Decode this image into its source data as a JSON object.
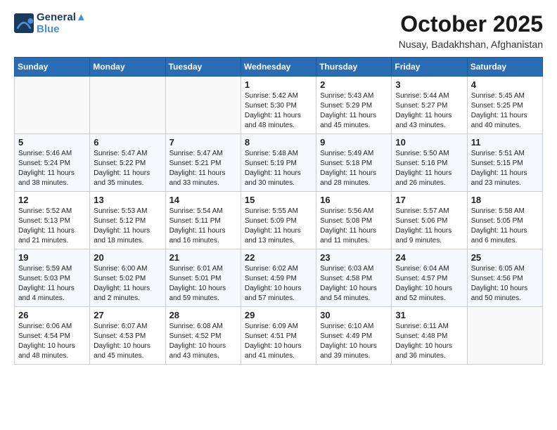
{
  "header": {
    "logo_line1": "General",
    "logo_line2": "Blue",
    "month": "October 2025",
    "location": "Nusay, Badakhshan, Afghanistan"
  },
  "weekdays": [
    "Sunday",
    "Monday",
    "Tuesday",
    "Wednesday",
    "Thursday",
    "Friday",
    "Saturday"
  ],
  "weeks": [
    [
      {
        "day": "",
        "info": ""
      },
      {
        "day": "",
        "info": ""
      },
      {
        "day": "",
        "info": ""
      },
      {
        "day": "1",
        "info": "Sunrise: 5:42 AM\nSunset: 5:30 PM\nDaylight: 11 hours and 48 minutes."
      },
      {
        "day": "2",
        "info": "Sunrise: 5:43 AM\nSunset: 5:29 PM\nDaylight: 11 hours and 45 minutes."
      },
      {
        "day": "3",
        "info": "Sunrise: 5:44 AM\nSunset: 5:27 PM\nDaylight: 11 hours and 43 minutes."
      },
      {
        "day": "4",
        "info": "Sunrise: 5:45 AM\nSunset: 5:25 PM\nDaylight: 11 hours and 40 minutes."
      }
    ],
    [
      {
        "day": "5",
        "info": "Sunrise: 5:46 AM\nSunset: 5:24 PM\nDaylight: 11 hours and 38 minutes."
      },
      {
        "day": "6",
        "info": "Sunrise: 5:47 AM\nSunset: 5:22 PM\nDaylight: 11 hours and 35 minutes."
      },
      {
        "day": "7",
        "info": "Sunrise: 5:47 AM\nSunset: 5:21 PM\nDaylight: 11 hours and 33 minutes."
      },
      {
        "day": "8",
        "info": "Sunrise: 5:48 AM\nSunset: 5:19 PM\nDaylight: 11 hours and 30 minutes."
      },
      {
        "day": "9",
        "info": "Sunrise: 5:49 AM\nSunset: 5:18 PM\nDaylight: 11 hours and 28 minutes."
      },
      {
        "day": "10",
        "info": "Sunrise: 5:50 AM\nSunset: 5:16 PM\nDaylight: 11 hours and 26 minutes."
      },
      {
        "day": "11",
        "info": "Sunrise: 5:51 AM\nSunset: 5:15 PM\nDaylight: 11 hours and 23 minutes."
      }
    ],
    [
      {
        "day": "12",
        "info": "Sunrise: 5:52 AM\nSunset: 5:13 PM\nDaylight: 11 hours and 21 minutes."
      },
      {
        "day": "13",
        "info": "Sunrise: 5:53 AM\nSunset: 5:12 PM\nDaylight: 11 hours and 18 minutes."
      },
      {
        "day": "14",
        "info": "Sunrise: 5:54 AM\nSunset: 5:11 PM\nDaylight: 11 hours and 16 minutes."
      },
      {
        "day": "15",
        "info": "Sunrise: 5:55 AM\nSunset: 5:09 PM\nDaylight: 11 hours and 13 minutes."
      },
      {
        "day": "16",
        "info": "Sunrise: 5:56 AM\nSunset: 5:08 PM\nDaylight: 11 hours and 11 minutes."
      },
      {
        "day": "17",
        "info": "Sunrise: 5:57 AM\nSunset: 5:06 PM\nDaylight: 11 hours and 9 minutes."
      },
      {
        "day": "18",
        "info": "Sunrise: 5:58 AM\nSunset: 5:05 PM\nDaylight: 11 hours and 6 minutes."
      }
    ],
    [
      {
        "day": "19",
        "info": "Sunrise: 5:59 AM\nSunset: 5:03 PM\nDaylight: 11 hours and 4 minutes."
      },
      {
        "day": "20",
        "info": "Sunrise: 6:00 AM\nSunset: 5:02 PM\nDaylight: 11 hours and 2 minutes."
      },
      {
        "day": "21",
        "info": "Sunrise: 6:01 AM\nSunset: 5:01 PM\nDaylight: 10 hours and 59 minutes."
      },
      {
        "day": "22",
        "info": "Sunrise: 6:02 AM\nSunset: 4:59 PM\nDaylight: 10 hours and 57 minutes."
      },
      {
        "day": "23",
        "info": "Sunrise: 6:03 AM\nSunset: 4:58 PM\nDaylight: 10 hours and 54 minutes."
      },
      {
        "day": "24",
        "info": "Sunrise: 6:04 AM\nSunset: 4:57 PM\nDaylight: 10 hours and 52 minutes."
      },
      {
        "day": "25",
        "info": "Sunrise: 6:05 AM\nSunset: 4:56 PM\nDaylight: 10 hours and 50 minutes."
      }
    ],
    [
      {
        "day": "26",
        "info": "Sunrise: 6:06 AM\nSunset: 4:54 PM\nDaylight: 10 hours and 48 minutes."
      },
      {
        "day": "27",
        "info": "Sunrise: 6:07 AM\nSunset: 4:53 PM\nDaylight: 10 hours and 45 minutes."
      },
      {
        "day": "28",
        "info": "Sunrise: 6:08 AM\nSunset: 4:52 PM\nDaylight: 10 hours and 43 minutes."
      },
      {
        "day": "29",
        "info": "Sunrise: 6:09 AM\nSunset: 4:51 PM\nDaylight: 10 hours and 41 minutes."
      },
      {
        "day": "30",
        "info": "Sunrise: 6:10 AM\nSunset: 4:49 PM\nDaylight: 10 hours and 39 minutes."
      },
      {
        "day": "31",
        "info": "Sunrise: 6:11 AM\nSunset: 4:48 PM\nDaylight: 10 hours and 36 minutes."
      },
      {
        "day": "",
        "info": ""
      }
    ]
  ]
}
